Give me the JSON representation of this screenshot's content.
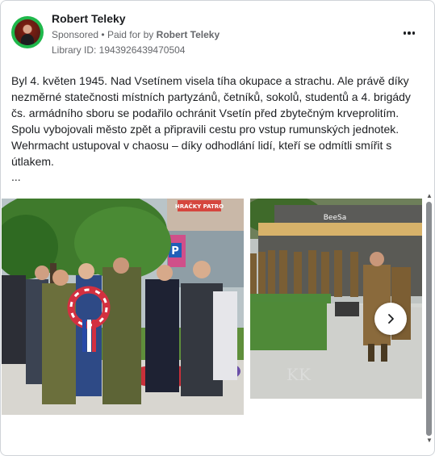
{
  "post": {
    "author": "Robert Teleky",
    "sponsored_label": "Sponsored",
    "separator": "•",
    "paid_for_by_label": "Paid for by",
    "paid_for_by_name": "Robert Teleky",
    "library_id": "Library ID: 1943926439470504",
    "text": "Byl 4. květen 1945. Nad Vsetínem visela tíha okupace a strachu. Ale právě díky nezměrné statečnosti místních partyzánů, četníků, sokolů, studentů a 4. brigády čs. armádního sboru se podařilo ochránit Vsetín před zbytečným krveprolitím. Spolu vybojovali město zpět a připravili cestu pro vstup rumunských jednotek. Wehrmacht ustupoval v chaosu – díky odhodlání lidí, kteří se odmítli smířit s útlakem.",
    "truncation": "..."
  },
  "photos": {
    "photo1_shop_sign": "HRAČKY PATRO",
    "photo1_parking": "P",
    "photo2_shop_sign": "BeeSa",
    "photo2_watermark": "KK"
  },
  "icons": {
    "more": "more-horizontal-icon",
    "next": "chevron-right-icon",
    "scroll_up": "triangle-up-icon",
    "scroll_down": "triangle-down-icon"
  },
  "colors": {
    "avatar_ring": "#1fb84b",
    "text_primary": "#1c1e21",
    "text_secondary": "#65676b",
    "border": "#cfd3d8"
  }
}
